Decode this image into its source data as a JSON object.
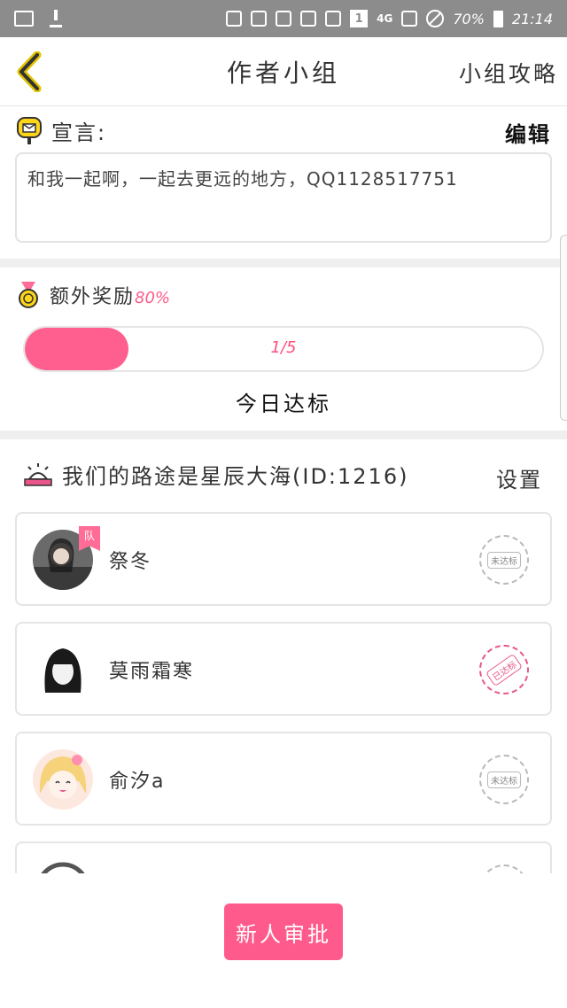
{
  "status_bar": {
    "battery": "70%",
    "time": "21:14",
    "network": "4G",
    "sim": "1"
  },
  "nav": {
    "title": "作者小组",
    "right_link": "小组攻略",
    "back_icon": "chevron-left-icon"
  },
  "declaration": {
    "label": "宣言:",
    "edit": "编辑",
    "text": "和我一起啊，一起去更远的地方，QQ1128517751",
    "icon": "mailbox-icon"
  },
  "bonus": {
    "label": "额外奖励",
    "percent": "80%",
    "progress_text": "1/5",
    "progress_fraction": 0.2,
    "status": "今日达标",
    "icon": "medal-icon"
  },
  "group": {
    "name": "我们的路途是星辰大海(ID:1216)",
    "settings": "设置",
    "icon": "group-emblem-icon",
    "members": [
      {
        "name": "祭冬",
        "badge": "队",
        "stamp": "未达标",
        "done": false
      },
      {
        "name": "莫雨霜寒",
        "badge": "",
        "stamp": "已达标",
        "done": true
      },
      {
        "name": "俞汐a",
        "badge": "",
        "stamp": "未达标",
        "done": false
      },
      {
        "name": "",
        "badge": "",
        "stamp": "",
        "done": false
      }
    ]
  },
  "approve_button": "新人审批",
  "colors": {
    "accent": "#ff5f8f",
    "border": "#e5e5e5",
    "status_bar": "#8c8c8c"
  }
}
